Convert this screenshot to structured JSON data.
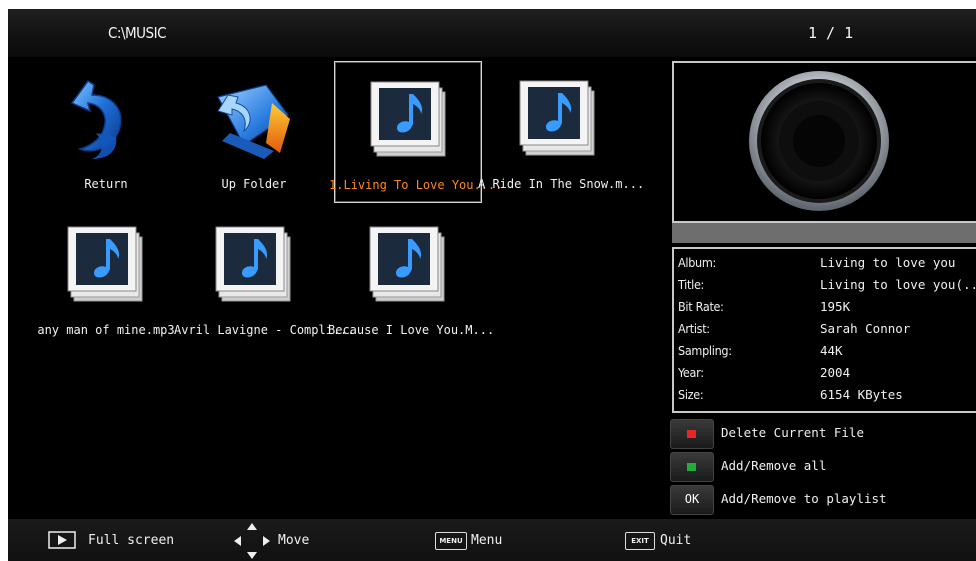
{
  "header": {
    "path": "C:\\MUSIC",
    "page_indicator": "1 / 1"
  },
  "items": [
    {
      "label": "Return",
      "icon": "return-arrow-icon"
    },
    {
      "label": "Up Folder",
      "icon": "up-folder-icon"
    },
    {
      "label": "1.Living To Love You....",
      "icon": "music-file-icon",
      "selected": true
    },
    {
      "label": "A Ride In The Snow.m...",
      "icon": "music-file-icon"
    },
    {
      "label": "any man of mine.mp3",
      "icon": "music-file-icon"
    },
    {
      "label": "Avril Lavigne - Compli...",
      "icon": "music-file-icon"
    },
    {
      "label": "Because I Love You.M...",
      "icon": "music-file-icon"
    }
  ],
  "preview": {
    "icon": "speaker-icon"
  },
  "info": {
    "album_label": "Album:",
    "album": "Living to love you",
    "title_label": "Title:",
    "title": "Living to love you(...",
    "bitrate_label": "Bit Rate:",
    "bitrate": "195K",
    "artist_label": "Artist:",
    "artist": "Sarah Connor",
    "sampling_label": "Sampling:",
    "sampling": "44K",
    "year_label": "Year:",
    "year": "2004",
    "size_label": "Size:",
    "size": "6154 KBytes"
  },
  "actions": {
    "delete_label": "Delete Current File",
    "addremove_all_label": "Add/Remove all",
    "ok_key": "OK",
    "playlist_label": "Add/Remove to playlist"
  },
  "footer": {
    "fullscreen": "Full screen",
    "move": "Move",
    "menu_key": "MENU",
    "menu": "Menu",
    "exit_key": "EXIT",
    "quit": "Quit"
  },
  "colors": {
    "red_key": "#e8262a",
    "green_key": "#1fae3c",
    "selected_label": "#ff8a1a"
  }
}
